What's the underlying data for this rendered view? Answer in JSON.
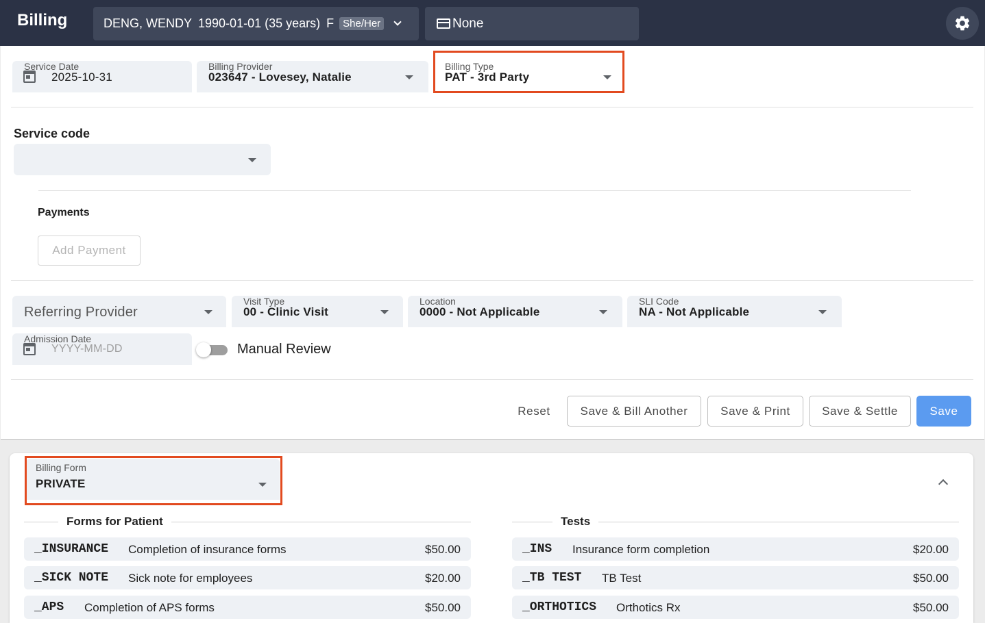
{
  "header": {
    "app_title": "Billing",
    "patient_name": "DENG, WENDY",
    "patient_dob": "1990-01-01 (35 years)",
    "patient_sex": "F",
    "pronouns": "She/Her",
    "coverage": "None"
  },
  "billing": {
    "service_date": {
      "label": "Service Date",
      "value": "2025-10-31"
    },
    "billing_provider": {
      "label": "Billing Provider",
      "value": "023647 - Lovesey, Natalie"
    },
    "billing_type": {
      "label": "Billing Type",
      "value": "PAT - 3rd Party"
    },
    "service_code_label": "Service code",
    "service_code_value": "",
    "payments_label": "Payments",
    "add_payment_label": "Add Payment",
    "referring_provider_placeholder": "Referring Provider",
    "visit_type": {
      "label": "Visit Type",
      "value": "00 - Clinic Visit"
    },
    "location": {
      "label": "Location",
      "value": "0000 - Not Applicable"
    },
    "sli_code": {
      "label": "SLI Code",
      "value": "NA - Not Applicable"
    },
    "admission_date": {
      "label": "Admission Date",
      "placeholder": "YYYY-MM-DD"
    },
    "manual_review_label": "Manual Review",
    "manual_review_on": false
  },
  "actions": {
    "reset": "Reset",
    "save_bill_another": "Save & Bill Another",
    "save_print": "Save & Print",
    "save_settle": "Save & Settle",
    "save": "Save"
  },
  "billing_form": {
    "label": "Billing Form",
    "value": "PRIVATE",
    "groups": [
      {
        "title": "Forms for Patient",
        "items": [
          {
            "code": "_INSURANCE",
            "desc": "Completion of insurance forms",
            "price": "$50.00"
          },
          {
            "code": "_SICK NOTE",
            "desc": "Sick note for employees",
            "price": "$20.00"
          },
          {
            "code": "_APS",
            "desc": "Completion of APS forms",
            "price": "$50.00"
          }
        ]
      },
      {
        "title": "Tests",
        "items": [
          {
            "code": "_INS",
            "desc": "Insurance form completion",
            "price": "$20.00"
          },
          {
            "code": "_TB TEST",
            "desc": "TB Test",
            "price": "$50.00"
          },
          {
            "code": "_ORTHOTICS",
            "desc": "Orthotics Rx",
            "price": "$50.00"
          }
        ]
      }
    ]
  },
  "colors": {
    "header_bg": "#2b3245",
    "highlight": "#e24a1f",
    "primary": "#5b9bf0",
    "field_bg": "#eef1f5"
  },
  "icons": [
    "chevron-down-icon",
    "credit-card-icon",
    "gear-icon",
    "calendar-icon",
    "dropdown-caret-icon",
    "chevron-up-icon"
  ]
}
